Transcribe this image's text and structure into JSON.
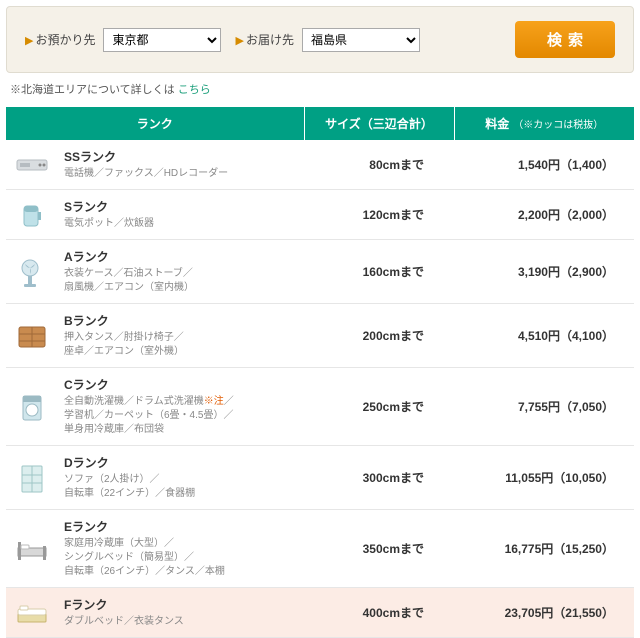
{
  "search": {
    "from_label": "お預かり先",
    "from_value": "東京都",
    "to_label": "お届け先",
    "to_value": "福島県",
    "button": "検索"
  },
  "note": {
    "prefix": "※北海道エリアについて詳しくは ",
    "link": "こちら"
  },
  "table": {
    "headers": {
      "rank": "ランク",
      "size": "サイズ（三辺合計）",
      "price": "料金",
      "price_sub": "（※カッコは税抜）"
    },
    "rows": [
      {
        "icon": "vcr",
        "name": "SSランク",
        "desc": "電話機／ファックス／HDレコーダー",
        "size": "80cmまで",
        "price": "1,540円（1,400）"
      },
      {
        "icon": "pot",
        "name": "Sランク",
        "desc": "電気ポット／炊飯器",
        "size": "120cmまで",
        "price": "2,200円（2,000）"
      },
      {
        "icon": "fan",
        "name": "Aランク",
        "desc": "衣装ケース／石油ストーブ／\n扇風機／エアコン（室内機）",
        "size": "160cmまで",
        "price": "3,190円（2,900）"
      },
      {
        "icon": "dresser",
        "name": "Bランク",
        "desc": "押入タンス／肘掛け椅子／\n座卓／エアコン（室外機）",
        "size": "200cmまで",
        "price": "4,510円（4,100）"
      },
      {
        "icon": "washer",
        "name": "Cランク",
        "desc_html": "全自動洗濯機／ドラム式洗濯機<span class='note-red'>※注</span>／\n学習机／カーペット（6畳・4.5畳）／\n単身用冷蔵庫／布団袋",
        "size": "250cmまで",
        "price": "7,755円（7,050）"
      },
      {
        "icon": "shelf",
        "name": "Dランク",
        "desc": "ソファ（2人掛け）／\n自転車（22インチ）／食器棚",
        "size": "300cmまで",
        "price": "11,055円（10,050）"
      },
      {
        "icon": "bed1",
        "name": "Eランク",
        "desc": "家庭用冷蔵庫（大型）／\nシングルベッド（簡易型）／\n自転車（26インチ）／タンス／本棚",
        "size": "350cmまで",
        "price": "16,775円（15,250）"
      },
      {
        "icon": "bed2",
        "name": "Fランク",
        "desc": "ダブルベッド／衣装タンス",
        "size": "400cmまで",
        "price": "23,705円（21,550）",
        "highlight": true
      }
    ]
  },
  "icons": {
    "vcr": "<svg viewBox='0 0 36 34'><rect x='3' y='12' width='30' height='10' rx='2' fill='#d9dde0' stroke='#b6bcc1'/><rect x='6' y='15' width='10' height='4' fill='#b6bcc1'/><circle cx='26' cy='17' r='1.5' fill='#888'/><circle cx='30' cy='17' r='1.5' fill='#888'/></svg>",
    "pot": "<svg viewBox='0 0 36 34'><rect x='10' y='8' width='14' height='20' rx='3' fill='#bfe1e8' stroke='#8fbfc8'/><rect x='10' y='8' width='14' height='6' rx='3' fill='#8fbfc8'/><rect x='24' y='14' width='3' height='8' fill='#8fbfc8'/></svg>",
    "fan": "<svg viewBox='0 0 36 34'><circle cx='16' cy='13' r='8' fill='#d8e9ef' stroke='#9fbecb'/><path d='M16 13 l5 -4 a6 6 0 0 1 -5 4z M16 13 l-5 -4 a6 6 0 0 0 5 4z M16 13 l0 6 a6 6 0 0 0 0 -6z' fill='#9fbecb'/><rect x='14' y='21' width='4' height='8' fill='#9fbecb'/><rect x='10' y='29' width='12' height='3' rx='1' fill='#9fbecb'/></svg>",
    "dresser": "<svg viewBox='0 0 36 34'><rect x='5' y='8' width='26' height='20' rx='2' fill='#c98b4f' stroke='#a06a39'/><line x1='5' y1='15' x2='31' y2='15' stroke='#a06a39'/><line x1='5' y1='22' x2='31' y2='22' stroke='#a06a39'/><line x1='18' y1='8' x2='18' y2='28' stroke='#a06a39'/></svg>",
    "washer": "<svg viewBox='0 0 36 34'><rect x='9' y='6' width='18' height='24' rx='2' fill='#d0e6ec' stroke='#9bbac3'/><rect x='9' y='6' width='18' height='6' fill='#9bbac3'/><circle cx='18' cy='20' r='6' fill='#fff' stroke='#9bbac3'/></svg>",
    "shelf": "<svg viewBox='0 0 36 34'><rect x='8' y='5' width='20' height='26' rx='1' fill='#dceeee' stroke='#9ec6c6'/><line x1='8' y1='14' x2='28' y2='14' stroke='#9ec6c6'/><line x1='8' y1='22' x2='28' y2='22' stroke='#9ec6c6'/><line x1='18' y1='5' x2='18' y2='31' stroke='#9ec6c6'/></svg>",
    "bed1": "<svg viewBox='0 0 36 34'><rect x='4' y='16' width='28' height='8' fill='#d8d8d8' stroke='#999'/><rect x='4' y='10' width='3' height='18' fill='#999'/><rect x='29' y='14' width='3' height='14' fill='#999'/><rect x='7' y='13' width='8' height='4' rx='1' fill='#fff' stroke='#bbb'/></svg>",
    "bed2": "<svg viewBox='0 0 36 34'><rect x='4' y='18' width='28' height='8' rx='1' fill='#e8dca8' stroke='#c7b56e'/><rect x='4' y='13' width='28' height='6' rx='2' fill='#fff' stroke='#d8ceab'/><rect x='6' y='10' width='8' height='4' rx='1' fill='#fff' stroke='#d8ceab'/></svg>"
  }
}
